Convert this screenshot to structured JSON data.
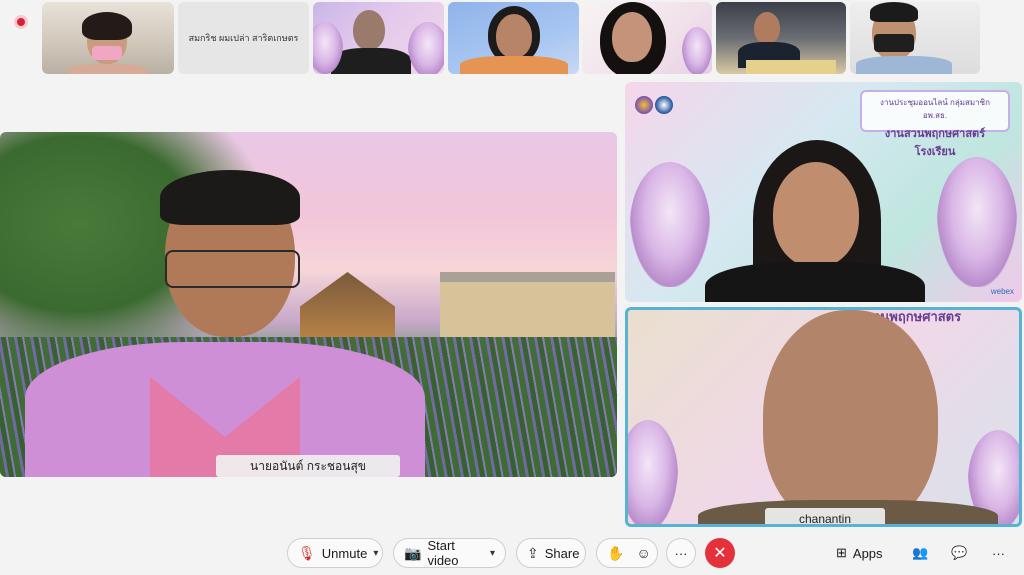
{
  "participants": {
    "thumb_2_name": "สมกริช ผมเปล่า สาริตเกษตร",
    "main_speaker_name": "นายอนันต์ กระชอนสุข",
    "tile_b_name": "chanantin"
  },
  "presentation": {
    "banner_line1": "งานประชุมออนไลน์ กลุ่มสมาชิก อพ.สธ.",
    "banner_line2": "งานสวนพฤกษศาสตร์โรงเรียน",
    "banner_b_text": "านสวนพฤกษศาสตร",
    "watermark": "webex"
  },
  "toolbar": {
    "unmute_label": "Unmute",
    "start_video_label": "Start video",
    "share_label": "Share",
    "more_label": "···",
    "leave_label": "✕",
    "apps_label": "Apps",
    "overflow_label": "···"
  },
  "icons": {
    "mic_muted": "🎙",
    "video_off": "📷",
    "share": "⇪",
    "raise_hand": "✋",
    "reactions": "☺",
    "apps": "⊞",
    "participants": "👥",
    "chat": "💬",
    "chevron": "▾"
  },
  "colors": {
    "leave": "#e4313b",
    "muted_red": "#d32f2f",
    "active_speaker_border": "#57b3d6",
    "recording": "#d6203a"
  }
}
